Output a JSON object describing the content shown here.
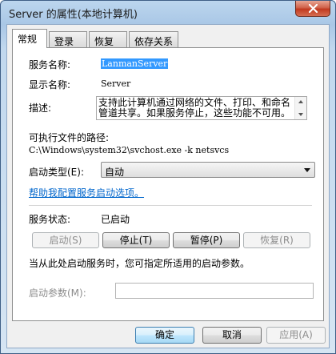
{
  "window": {
    "title": "Server 的属性(本地计算机)"
  },
  "tabs": [
    {
      "label": "常规",
      "active": true
    },
    {
      "label": "登录",
      "active": false
    },
    {
      "label": "恢复",
      "active": false
    },
    {
      "label": "依存关系",
      "active": false
    }
  ],
  "general": {
    "service_name_label": "服务名称:",
    "service_name_value": "LanmanServer",
    "display_name_label": "显示名称:",
    "display_name_value": "Server",
    "description_label": "描述:",
    "description_value": "支持此计算机通过网络的文件、打印、和命名管道共享。如果服务停止，这些功能不可用。",
    "exe_path_label": "可执行文件的路径:",
    "exe_path_value": "C:\\Windows\\system32\\svchost.exe -k netsvcs",
    "startup_type_label": "启动类型(E):",
    "startup_type_value": "自动",
    "help_link": "帮助我配置服务启动选项。",
    "status_label": "服务状态:",
    "status_value": "已启动",
    "start_button": "启动(S)",
    "stop_button": "停止(T)",
    "pause_button": "暂停(P)",
    "resume_button": "恢复(R)",
    "hint_text": "当从此处启动服务时，您可指定所适用的启动参数。",
    "start_params_label": "启动参数(M):",
    "start_params_value": ""
  },
  "footer": {
    "ok_button": "确定",
    "cancel_button": "取消",
    "apply_button": "应用(A)"
  }
}
